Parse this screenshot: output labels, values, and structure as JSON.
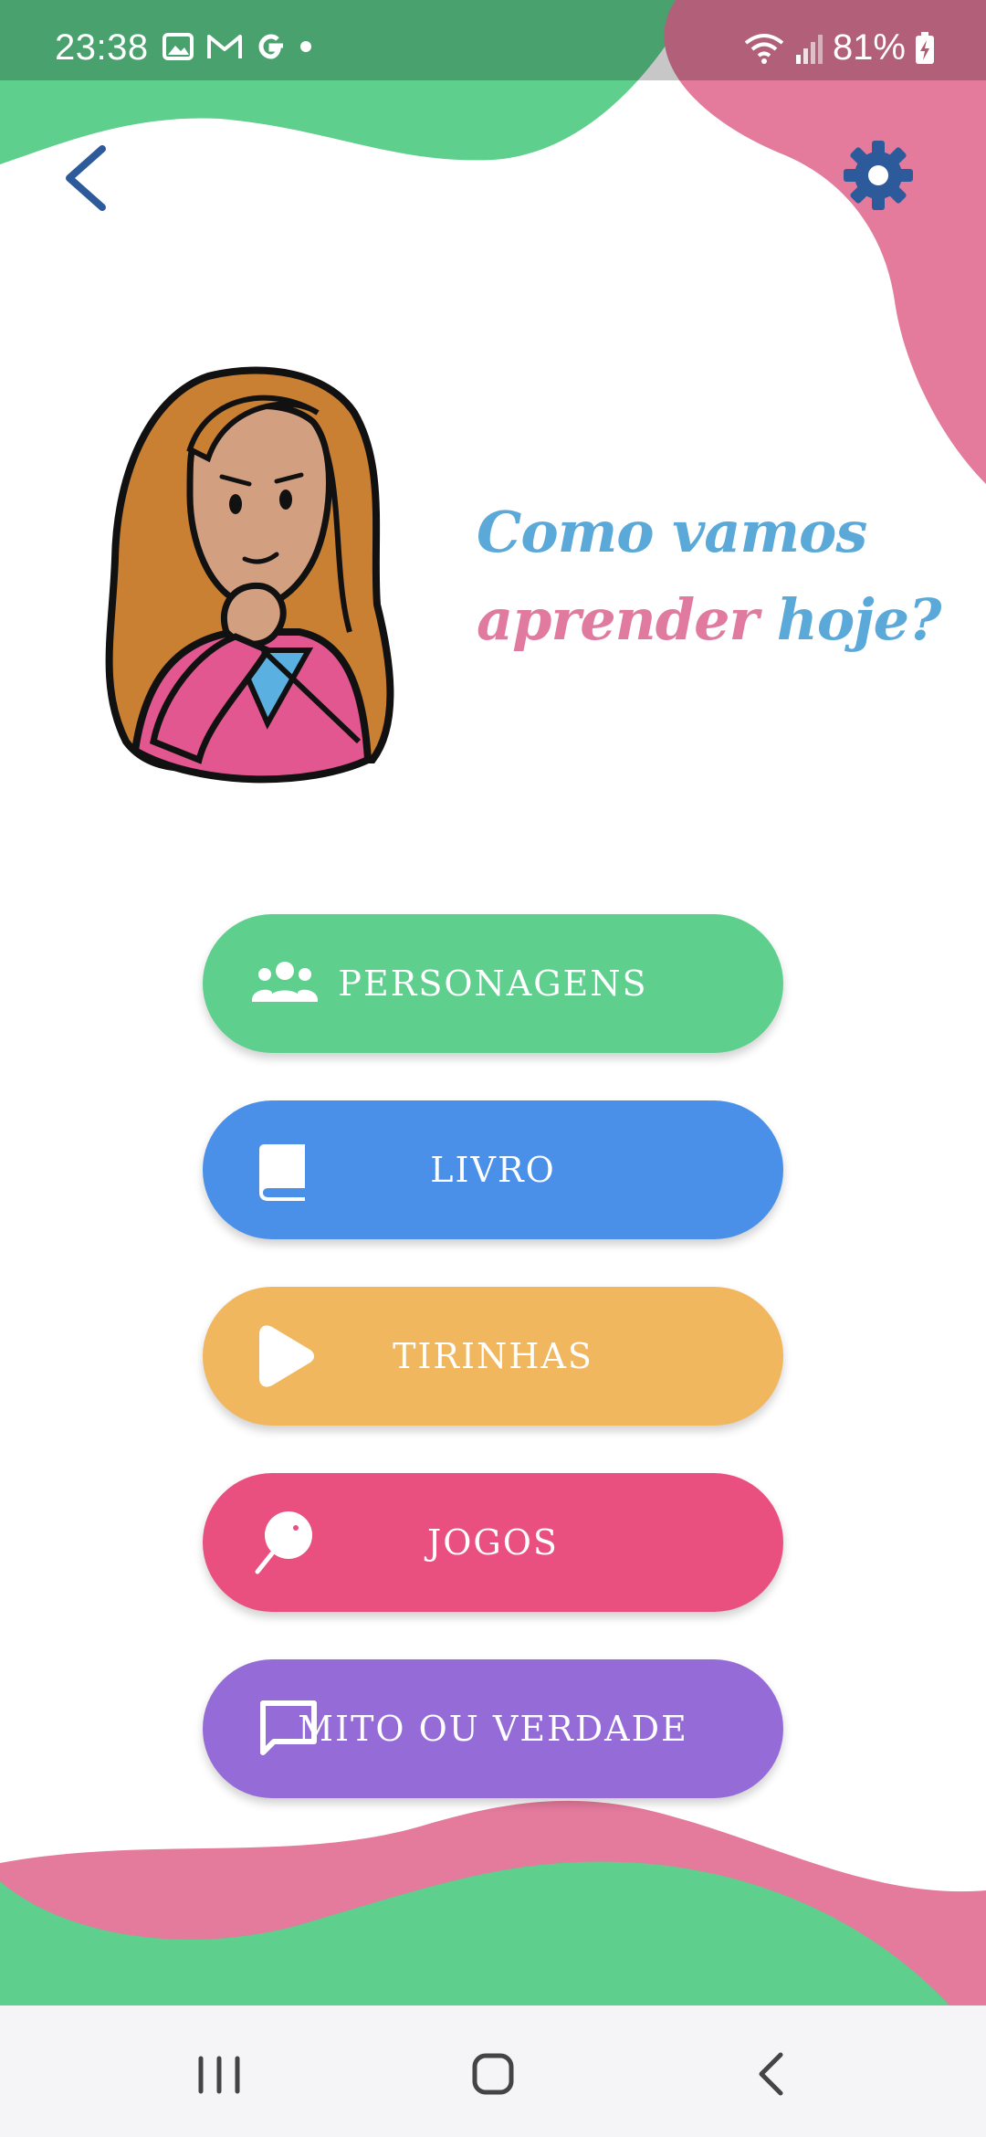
{
  "status_bar": {
    "time": "23:38",
    "notification_icons": [
      "gallery-icon",
      "gmail-icon",
      "google-icon",
      "dot-icon"
    ],
    "battery": "81%"
  },
  "header": {
    "back_icon": "chevron-left-icon",
    "settings_icon": "gear-icon"
  },
  "headline": {
    "line1": "Como vamos",
    "line2_word1": "aprender",
    "line2_word2": "hoje?"
  },
  "menu": [
    {
      "label": "PERSONAGENS",
      "icon": "group-icon",
      "color": "#5ecf8d"
    },
    {
      "label": "LIVRO",
      "icon": "book-icon",
      "color": "#4a90e8"
    },
    {
      "label": "TIRINHAS",
      "icon": "play-icon",
      "color": "#f0b75f"
    },
    {
      "label": "JOGOS",
      "icon": "lollipop-icon",
      "color": "#e9507f"
    },
    {
      "label": "MITO OU VERDADE",
      "icon": "chat-icon",
      "color": "#956bd8"
    }
  ],
  "colors": {
    "green": "#5ecf8d",
    "pink": "#e47a9c",
    "headline_blue": "#5aa9d8",
    "headline_pink": "#e07a9e",
    "icon_blue": "#2d5a9a"
  },
  "nav_bar": [
    "recent-apps-icon",
    "home-icon",
    "back-icon"
  ]
}
